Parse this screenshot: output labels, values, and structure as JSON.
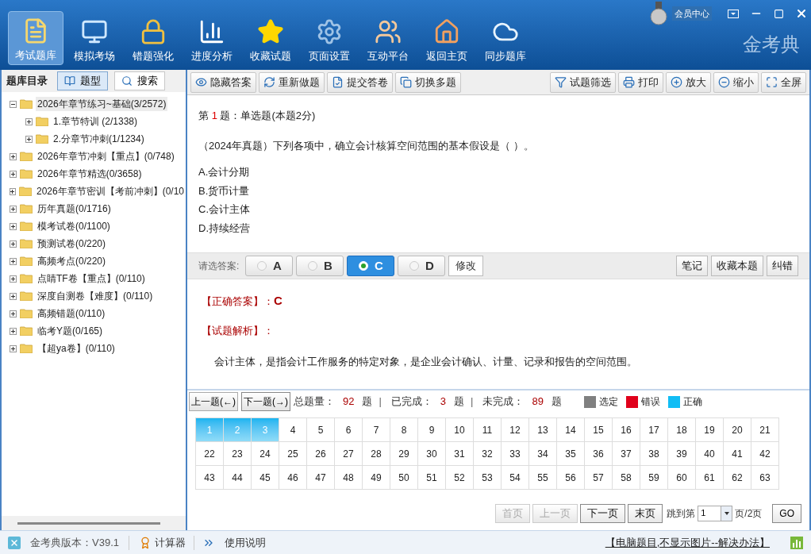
{
  "top_nav": [
    {
      "label": "考试题库",
      "selected": true
    },
    {
      "label": "模拟考场",
      "selected": false
    },
    {
      "label": "错题强化",
      "selected": false
    },
    {
      "label": "进度分析",
      "selected": false
    },
    {
      "label": "收藏试题",
      "selected": false
    },
    {
      "label": "页面设置",
      "selected": false
    },
    {
      "label": "互动平台",
      "selected": false
    },
    {
      "label": "返回主页",
      "selected": false
    },
    {
      "label": "同步题库",
      "selected": false
    }
  ],
  "member_center": "会员中心",
  "brand": "金考典",
  "sidebar": {
    "title": "题库目录",
    "tabs": [
      {
        "label": "题型",
        "selected": true
      },
      {
        "label": "搜索",
        "selected": false
      }
    ],
    "tree": [
      {
        "label": "2026年章节练习~基础(3/2572)",
        "expanded": true,
        "selected": true,
        "children": [
          {
            "label": "1.章节特训 (2/1338)",
            "expanded": false,
            "selected": false
          },
          {
            "label": "2.分章节冲刺(1/1234)",
            "expanded": false,
            "selected": false
          }
        ]
      },
      {
        "label": "2026年章节冲刺【重点】(0/748)",
        "expanded": false,
        "selected": false
      },
      {
        "label": "2026年章节精选(0/3658)",
        "expanded": false,
        "selected": false
      },
      {
        "label": "2026年章节密训【考前冲刺】(0/10",
        "expanded": false,
        "selected": false
      },
      {
        "label": "历年真题(0/1716)",
        "expanded": false,
        "selected": false
      },
      {
        "label": "模考试卷(0/1100)",
        "expanded": false,
        "selected": false
      },
      {
        "label": "预测试卷(0/220)",
        "expanded": false,
        "selected": false
      },
      {
        "label": "高频考点(0/220)",
        "expanded": false,
        "selected": false
      },
      {
        "label": "点睛TF卷【重点】(0/110)",
        "expanded": false,
        "selected": false
      },
      {
        "label": "深度自测卷【难度】(0/110)",
        "expanded": false,
        "selected": false
      },
      {
        "label": "高频错题(0/110)",
        "expanded": false,
        "selected": false
      },
      {
        "label": "临考Y题(0/165)",
        "expanded": false,
        "selected": false
      },
      {
        "label": "【超ya卷】(0/110)",
        "expanded": false,
        "selected": false
      }
    ]
  },
  "toolbar_left": [
    "隐藏答案",
    "重新做题",
    "提交答卷",
    "切换多题"
  ],
  "toolbar_right": [
    "试题筛选",
    "打印",
    "放大",
    "缩小",
    "全屏"
  ],
  "question": {
    "prefix": "第",
    "number": "1",
    "suffix": "题：单选题(本题2分)",
    "stem": "（2024年真题）下列各项中，确立会计核算空间范围的基本假设是（ ）。",
    "options": [
      "A.会计分期",
      "B.货币计量",
      "C.会计主体",
      "D.持续经营"
    ]
  },
  "answer_bar": {
    "label": "请选答案:",
    "choices": [
      {
        "label": "A",
        "selected": false
      },
      {
        "label": "B",
        "selected": false
      },
      {
        "label": "C",
        "selected": true
      },
      {
        "label": "D",
        "selected": false
      }
    ],
    "modify": "修改",
    "actions": [
      "笔记",
      "收藏本题",
      "纠错"
    ]
  },
  "answer": {
    "correct_label": "【正确答案】：",
    "correct_value": "C",
    "analysis_label": "【试题解析】：",
    "analysis": "会计主体，是指会计工作服务的特定对象，是企业会计确认、计量、记录和报告的空间范围。"
  },
  "nav": {
    "prev": "上一题(←)",
    "next": "下一题(→)",
    "stats": [
      {
        "label": "总题量：",
        "count": "92",
        "unit": "题",
        "separator": "|"
      },
      {
        "label": "已完成：",
        "count": "3",
        "unit": "题",
        "separator": "|"
      },
      {
        "label": "未完成：",
        "count": "89",
        "unit": "题"
      }
    ],
    "legend": [
      {
        "label": "选定",
        "color": "#808080"
      },
      {
        "label": "错误",
        "color": "#e0001b"
      },
      {
        "label": "正确",
        "color": "#11bdf5"
      }
    ]
  },
  "grid": [
    {
      "label": "1",
      "correct": true
    },
    {
      "label": "2",
      "correct": true
    },
    {
      "label": "3",
      "correct": true
    },
    {
      "label": "4",
      "correct": false
    },
    {
      "label": "5",
      "correct": false
    },
    {
      "label": "6",
      "correct": false
    },
    {
      "label": "7",
      "correct": false
    },
    {
      "label": "8",
      "correct": false
    },
    {
      "label": "9",
      "correct": false
    },
    {
      "label": "10",
      "correct": false
    },
    {
      "label": "11",
      "correct": false
    },
    {
      "label": "12",
      "correct": false
    },
    {
      "label": "13",
      "correct": false
    },
    {
      "label": "14",
      "correct": false
    },
    {
      "label": "15",
      "correct": false
    },
    {
      "label": "16",
      "correct": false
    },
    {
      "label": "17",
      "correct": false
    },
    {
      "label": "18",
      "correct": false
    },
    {
      "label": "19",
      "correct": false
    },
    {
      "label": "20",
      "correct": false
    },
    {
      "label": "21",
      "correct": false
    },
    {
      "label": "22",
      "correct": false
    },
    {
      "label": "23",
      "correct": false
    },
    {
      "label": "24",
      "correct": false
    },
    {
      "label": "25",
      "correct": false
    },
    {
      "label": "26",
      "correct": false
    },
    {
      "label": "27",
      "correct": false
    },
    {
      "label": "28",
      "correct": false
    },
    {
      "label": "29",
      "correct": false
    },
    {
      "label": "30",
      "correct": false
    },
    {
      "label": "31",
      "correct": false
    },
    {
      "label": "32",
      "correct": false
    },
    {
      "label": "33",
      "correct": false
    },
    {
      "label": "34",
      "correct": false
    },
    {
      "label": "35",
      "correct": false
    },
    {
      "label": "36",
      "correct": false
    },
    {
      "label": "37",
      "correct": false
    },
    {
      "label": "38",
      "correct": false
    },
    {
      "label": "39",
      "correct": false
    },
    {
      "label": "40",
      "correct": false
    },
    {
      "label": "41",
      "correct": false
    },
    {
      "label": "42",
      "correct": false
    },
    {
      "label": "43",
      "correct": false
    },
    {
      "label": "44",
      "correct": false
    },
    {
      "label": "45",
      "correct": false
    },
    {
      "label": "46",
      "correct": false
    },
    {
      "label": "47",
      "correct": false
    },
    {
      "label": "48",
      "correct": false
    },
    {
      "label": "49",
      "correct": false
    },
    {
      "label": "50",
      "correct": false
    },
    {
      "label": "51",
      "correct": false
    },
    {
      "label": "52",
      "correct": false
    },
    {
      "label": "53",
      "correct": false
    },
    {
      "label": "54",
      "correct": false
    },
    {
      "label": "55",
      "correct": false
    },
    {
      "label": "56",
      "correct": false
    },
    {
      "label": "57",
      "correct": false
    },
    {
      "label": "58",
      "correct": false
    },
    {
      "label": "59",
      "correct": false
    },
    {
      "label": "60",
      "correct": false
    },
    {
      "label": "61",
      "correct": false
    },
    {
      "label": "62",
      "correct": false
    },
    {
      "label": "63",
      "correct": false
    }
  ],
  "pager": {
    "buttons": [
      {
        "label": "首页",
        "disabled": true
      },
      {
        "label": "上一页",
        "disabled": true
      },
      {
        "label": "下一页",
        "disabled": false
      },
      {
        "label": "末页",
        "disabled": false
      }
    ],
    "jump_label": "跳到第",
    "page": "1",
    "of": "页/2页",
    "go": "GO"
  },
  "status_bar": {
    "version": "金考典版本：V39.1",
    "calculator": "计算器",
    "help": "使用说明",
    "link": "【电脑题目,不显示图片--解决办法】"
  }
}
